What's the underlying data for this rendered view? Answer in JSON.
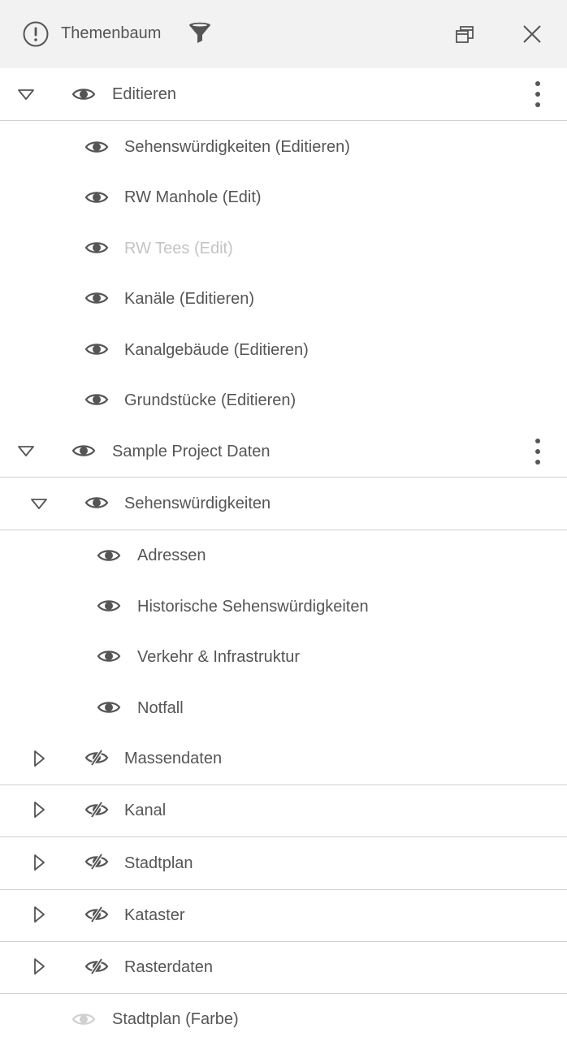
{
  "header": {
    "title": "Themenbaum",
    "icons": [
      "info-icon",
      "filter-icon",
      "restore-window-icon",
      "close-icon"
    ]
  },
  "tree": {
    "editieren": {
      "label": "Editieren",
      "children": [
        {
          "label": "Sehenswürdigkeiten (Editieren)",
          "visible": true,
          "enabled": true
        },
        {
          "label": "RW Manhole (Edit)",
          "visible": true,
          "enabled": true
        },
        {
          "label": "RW Tees (Edit)",
          "visible": true,
          "enabled": false
        },
        {
          "label": "Kanäle (Editieren)",
          "visible": true,
          "enabled": true
        },
        {
          "label": "Kanalgebäude (Editieren)",
          "visible": true,
          "enabled": true
        },
        {
          "label": "Grundstücke (Editieren)",
          "visible": true,
          "enabled": true
        }
      ]
    },
    "sample_project": {
      "label": "Sample Project Daten",
      "sehenswuerdigkeiten": {
        "label": "Sehenswürdigkeiten",
        "children": [
          {
            "label": "Adressen",
            "visible": true
          },
          {
            "label": "Historische Sehenswürdigkeiten",
            "visible": true
          },
          {
            "label": "Verkehr & Infrastruktur",
            "visible": true
          },
          {
            "label": "Notfall",
            "visible": true
          }
        ]
      },
      "groups": [
        {
          "label": "Massendaten",
          "visible": false
        },
        {
          "label": "Kanal",
          "visible": false
        },
        {
          "label": "Stadtplan",
          "visible": false
        },
        {
          "label": "Kataster",
          "visible": false
        },
        {
          "label": "Rasterdaten",
          "visible": false
        }
      ]
    },
    "stadtplan_farbe": {
      "label": "Stadtplan (Farbe)",
      "visible": true,
      "enabled": false
    }
  }
}
